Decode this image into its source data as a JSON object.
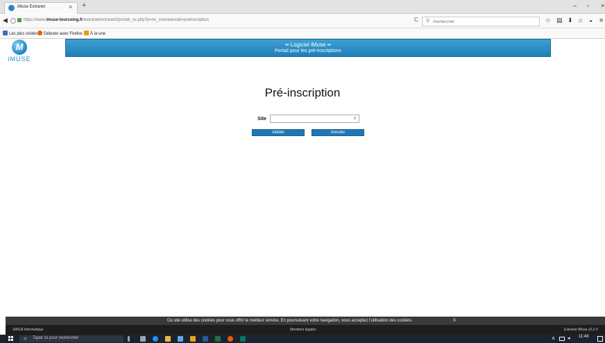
{
  "browser": {
    "tab_title": "iMuse Extranet",
    "tab_close": "×",
    "new_tab": "+",
    "win_min": "–",
    "win_max": "▫",
    "win_close": "×",
    "url_prefix": "https://www.",
    "url_domain": "imuse-tourcoing.fr",
    "url_path": "/extranet/extranet2/portail_nc.php?p=nc_connexion&t=preinscription",
    "search_placeholder": "Rechercher",
    "bookmarks": [
      {
        "label": "Les plus visités",
        "icon": "star-folder-icon",
        "color": "#3b6fc9"
      },
      {
        "label": "Débuter avec Firefox",
        "icon": "firefox-icon",
        "color": "#e66000"
      },
      {
        "label": "À la une",
        "icon": "rss-icon",
        "color": "#e8a100"
      }
    ]
  },
  "page": {
    "logo_text": "iMUSE",
    "banner_title": "•• Logiciel iMuse ••",
    "banner_subtitle": "Portail pour les pré-inscriptions",
    "title": "Pré-inscription",
    "form": {
      "site_label": "Site",
      "site_value": ""
    },
    "buttons": {
      "validate": "Valider",
      "cancel": "Annuler"
    },
    "cookie_notice": "Ce site utilise des cookies pour vous offrir le meilleur service. En poursuivant votre navigation, vous acceptez l'utilisation des cookies.",
    "cookie_close": "X",
    "footer": {
      "left": "SAIGA Informatique",
      "center": "Mentions légales",
      "right": "Extranet iMuse v2.2.0"
    }
  },
  "taskbar": {
    "search_placeholder": "Taper ici pour rechercher",
    "clock": "11:43",
    "apps": [
      {
        "name": "task-view-icon",
        "color": "#9aa4b0"
      },
      {
        "name": "edge-icon",
        "color": "#1e90ff"
      },
      {
        "name": "file-explorer-icon",
        "color": "#e8b84a"
      },
      {
        "name": "store-icon",
        "color": "#5fa8e0"
      },
      {
        "name": "mail-icon",
        "color": "#f0a020"
      },
      {
        "name": "word-icon",
        "color": "#2b5797"
      },
      {
        "name": "excel-icon",
        "color": "#1e7145"
      },
      {
        "name": "firefox-icon",
        "color": "#e66000"
      },
      {
        "name": "publisher-icon",
        "color": "#077568"
      }
    ]
  }
}
